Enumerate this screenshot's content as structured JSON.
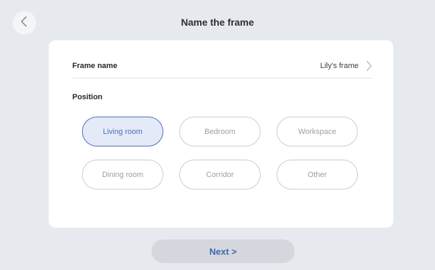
{
  "header": {
    "title": "Name the frame",
    "back_icon": "chevron-left-icon"
  },
  "frame_name": {
    "label": "Frame name",
    "value": "Lily's frame",
    "icon": "chevron-right-icon"
  },
  "position": {
    "label": "Position",
    "options": [
      "Living room",
      "Bedroom",
      "Workspace",
      "Dining room",
      "Corridor",
      "Other"
    ],
    "selected": "Living room"
  },
  "footer": {
    "next_label": "Next >"
  },
  "colors": {
    "background": "#e6e9ee",
    "accent": "#4a6fb5",
    "selected_fill": "#e4eaf8",
    "next_button": "#d4d8de"
  }
}
